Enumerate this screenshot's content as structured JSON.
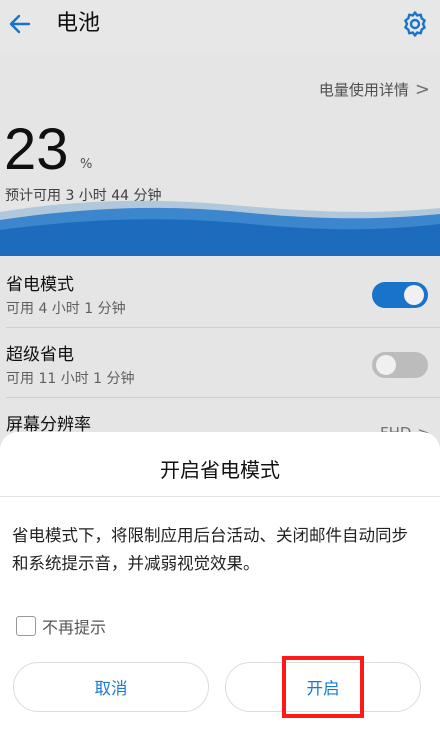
{
  "header": {
    "title": "电池",
    "back_icon": "arrow-left-icon",
    "settings_icon": "gear-icon"
  },
  "summary": {
    "usage_link": "电量使用详情",
    "usage_chevron": ">",
    "percent": "23",
    "percent_unit": "%",
    "remaining": "预计可用 3 小时 44 分钟"
  },
  "rows": [
    {
      "title": "省电模式",
      "subtitle": "可用 4 小时 1 分钟",
      "toggle": "on"
    },
    {
      "title": "超级省电",
      "subtitle": "可用 11 小时 1 分钟",
      "toggle": "off"
    },
    {
      "title": "屏幕分辨率",
      "value": "FHD",
      "chevron": ">"
    }
  ],
  "dialog": {
    "title": "开启省电模式",
    "message": "省电模式下，将限制应用后台活动、关闭邮件自动同步和系统提示音，并减弱视觉效果。",
    "checkbox_label": "不再提示",
    "checkbox_checked": false,
    "cancel_label": "取消",
    "confirm_label": "开启"
  },
  "colors": {
    "accent": "#1a7bd6",
    "highlight_box": "#ff1a1a"
  }
}
